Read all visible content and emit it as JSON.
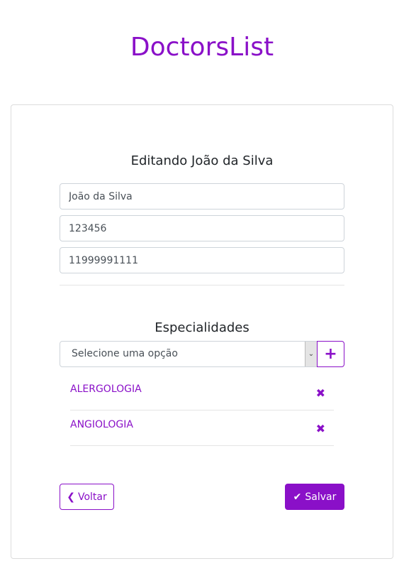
{
  "app": {
    "title": "DoctorsList"
  },
  "form": {
    "heading": "Editando João da Silva",
    "name_value": "João da Silva",
    "crm_value": "123456",
    "phone_value": "11999991111"
  },
  "specialties": {
    "heading": "Especialidades",
    "select_placeholder": "Selecione uma opção",
    "add_icon": "plus-icon",
    "items": [
      {
        "label": "ALERGOLOGIA"
      },
      {
        "label": "ANGIOLOGIA"
      }
    ]
  },
  "actions": {
    "back_label": "Voltar",
    "save_label": "Salvar"
  },
  "colors": {
    "accent": "#8a10c8",
    "border": "#ced4da",
    "text": "#212529"
  }
}
